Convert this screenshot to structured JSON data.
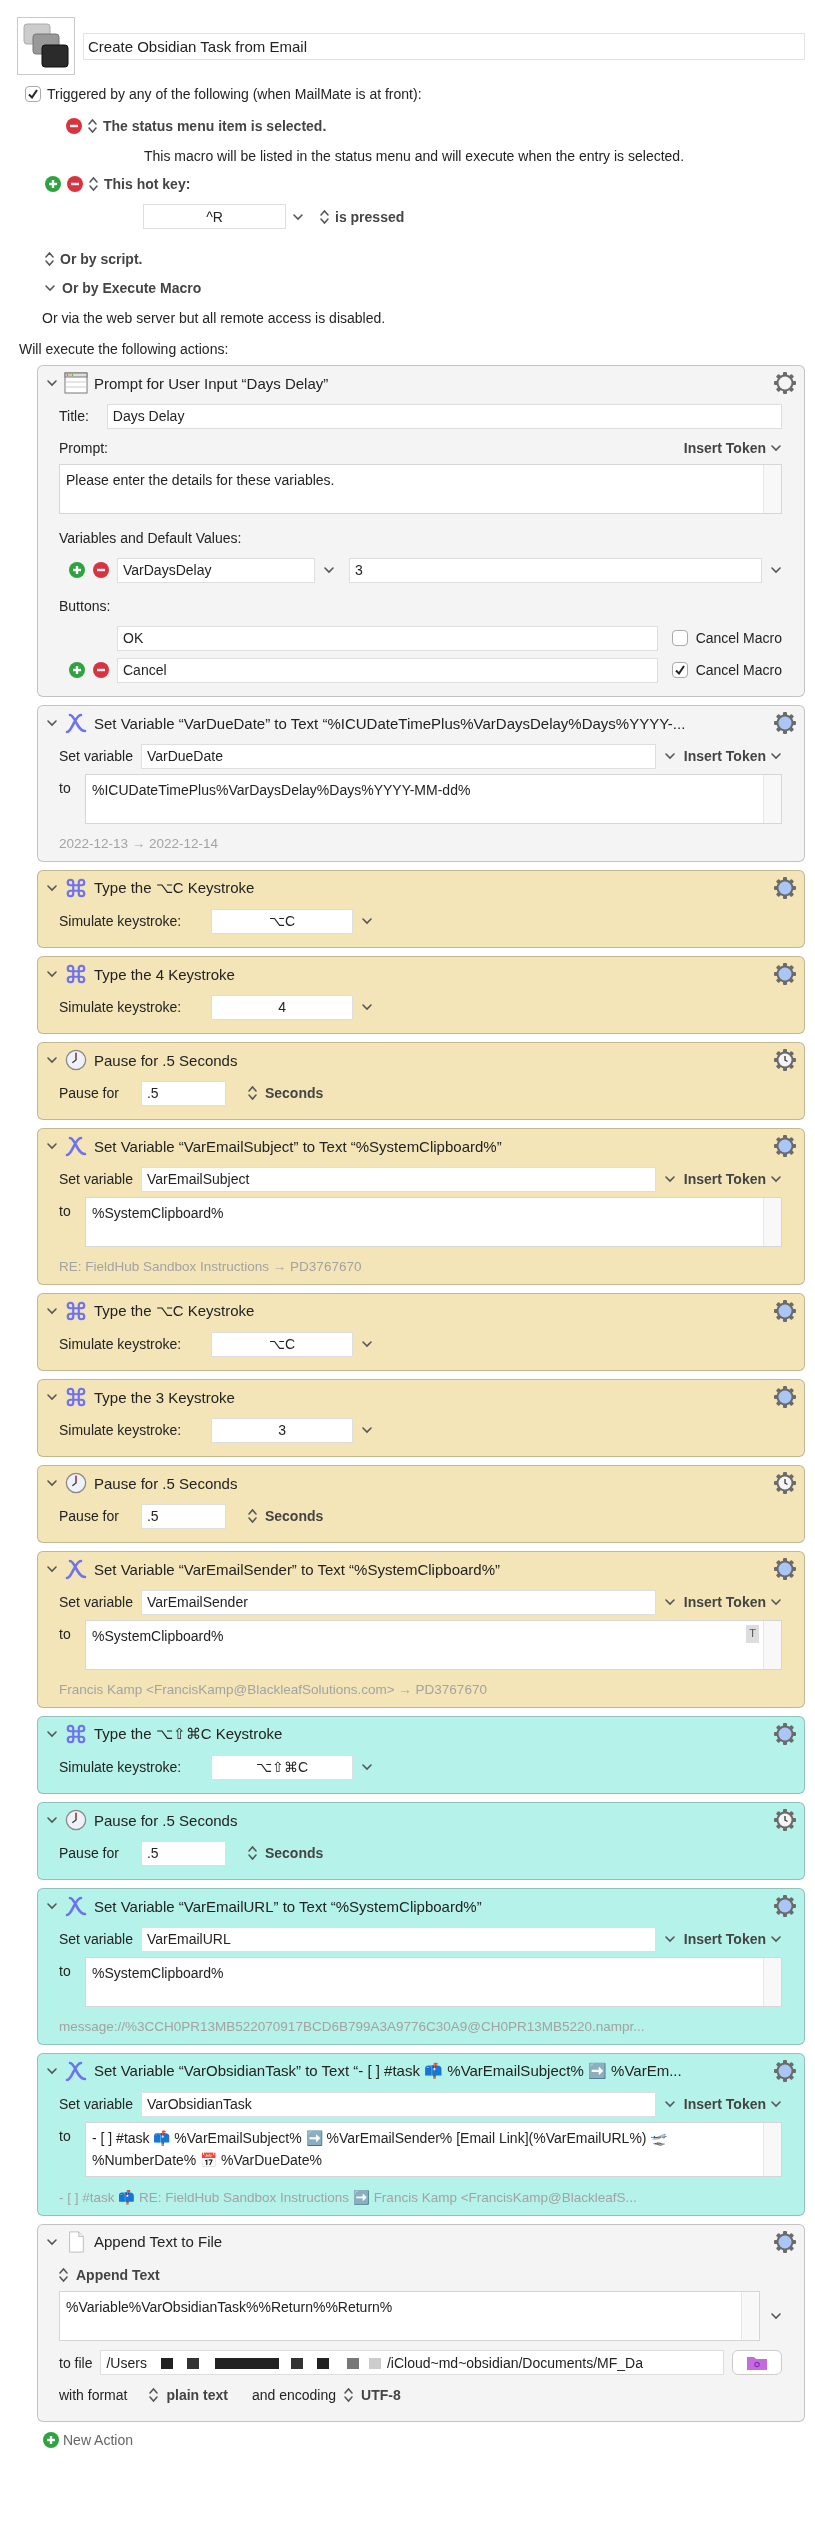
{
  "macro": {
    "title": "Create Obsidian Task from Email"
  },
  "triggers": {
    "enabled": true,
    "heading": "Triggered by any of the following (when MailMate is at front):",
    "items": [
      {
        "kind": "status_menu",
        "label": "The status menu item is selected.",
        "description": "This macro will be listed in the status menu and will execute when the entry is selected."
      },
      {
        "kind": "hotkey",
        "label": "This hot key:",
        "key": "^R",
        "condition": "is pressed"
      },
      {
        "kind": "script",
        "label": "Or by script."
      },
      {
        "kind": "execute_macro",
        "label": "Or by Execute Macro",
        "expanded": true
      }
    ],
    "remote_note": "Or via the web server but all remote access is disabled."
  },
  "actions_heading": "Will execute the following actions:",
  "actions": [
    {
      "kind": "prompt",
      "color": "#f4f4f4",
      "expanded": true,
      "title": "Prompt for User Input “Days Delay”",
      "title_label": "Title:",
      "title_value": "Days Delay",
      "prompt_label": "Prompt:",
      "insert_token": "Insert Token",
      "prompt": "Please enter the details for these variables.",
      "variables_label": "Variables and Default Values:",
      "variables": [
        {
          "name": "VarDaysDelay",
          "default": "3"
        }
      ],
      "buttons_label": "Buttons:",
      "buttons": [
        {
          "label": "OK",
          "cancel_macro": false,
          "cancel_label": "Cancel Macro"
        },
        {
          "label": "Cancel",
          "cancel_macro": true,
          "cancel_label": "Cancel Macro"
        }
      ]
    },
    {
      "kind": "set_variable",
      "color": "#f4f4f4",
      "expanded": true,
      "title": "Set Variable “VarDueDate” to Text “%ICUDateTimePlus%VarDaysDelay%Days%YYYY-...",
      "set_label": "Set variable",
      "variable": "VarDueDate",
      "insert_token": "Insert Token",
      "to_label": "to",
      "value": "%ICUDateTimePlus%VarDaysDelay%Days%YYYY-MM-dd%",
      "preview": "2022-12-13 → 2022-12-14"
    },
    {
      "kind": "keystroke",
      "color": "#f3e5b7",
      "expanded": true,
      "title": "Type the ⌥C Keystroke",
      "label": "Simulate keystroke:",
      "key": "⌥C"
    },
    {
      "kind": "keystroke",
      "color": "#f3e5b7",
      "expanded": true,
      "title": "Type the 4 Keystroke",
      "label": "Simulate keystroke:",
      "key": "4"
    },
    {
      "kind": "pause",
      "color": "#f3e5b7",
      "expanded": true,
      "title": "Pause for .5 Seconds",
      "label": "Pause for",
      "value": ".5",
      "unit": "Seconds"
    },
    {
      "kind": "set_variable",
      "color": "#f3e5b7",
      "expanded": true,
      "title": "Set Variable “VarEmailSubject” to Text “%SystemClipboard%”",
      "set_label": "Set variable",
      "variable": "VarEmailSubject",
      "insert_token": "Insert Token",
      "to_label": "to",
      "value": "%SystemClipboard%",
      "preview": "RE: FieldHub Sandbox Instructions → PD3767670"
    },
    {
      "kind": "keystroke",
      "color": "#f3e5b7",
      "expanded": true,
      "title": "Type the ⌥C Keystroke",
      "label": "Simulate keystroke:",
      "key": "⌥C"
    },
    {
      "kind": "keystroke",
      "color": "#f3e5b7",
      "expanded": true,
      "title": "Type the 3 Keystroke",
      "label": "Simulate keystroke:",
      "key": "3"
    },
    {
      "kind": "pause",
      "color": "#f3e5b7",
      "expanded": true,
      "title": "Pause for .5 Seconds",
      "label": "Pause for",
      "value": ".5",
      "unit": "Seconds"
    },
    {
      "kind": "set_variable",
      "color": "#f3e5b7",
      "expanded": true,
      "title": "Set Variable “VarEmailSender” to Text “%SystemClipboard%”",
      "set_label": "Set variable",
      "variable": "VarEmailSender",
      "insert_token": "Insert Token",
      "to_label": "to",
      "value": "%SystemClipboard%",
      "token_badge": "T",
      "preview": "Francis Kamp <FrancisKamp@BlackleafSolutions.com> → PD3767670"
    },
    {
      "kind": "keystroke",
      "color": "#b5f2e9",
      "expanded": true,
      "title": "Type the ⌥⇧⌘C Keystroke",
      "label": "Simulate keystroke:",
      "key": "⌥⇧⌘C"
    },
    {
      "kind": "pause",
      "color": "#b5f2e9",
      "expanded": true,
      "title": "Pause for .5 Seconds",
      "label": "Pause for",
      "value": ".5",
      "unit": "Seconds"
    },
    {
      "kind": "set_variable",
      "color": "#b5f2e9",
      "expanded": true,
      "title": "Set Variable “VarEmailURL” to Text “%SystemClipboard%”",
      "set_label": "Set variable",
      "variable": "VarEmailURL",
      "insert_token": "Insert Token",
      "to_label": "to",
      "value": "%SystemClipboard%",
      "preview": "message://%3CCH0PR13MB522070917BCD6B799A3A9776C30A9@CH0PR13MB5220.nampr..."
    },
    {
      "kind": "set_variable",
      "color": "#b5f2e9",
      "expanded": true,
      "title": "Set Variable “VarObsidianTask” to Text “- [ ] #task 📫 %VarEmailSubject% ➡️ %VarEm...",
      "set_label": "Set variable",
      "variable": "VarObsidianTask",
      "insert_token": "Insert Token",
      "to_label": "to",
      "value": "- [ ] #task 📫 %VarEmailSubject% ➡️ %VarEmailSender% [Email Link](%VarEmailURL%) 🛫 %NumberDate% 📅 %VarDueDate%",
      "preview": "- [ ] #task 📫 RE: FieldHub Sandbox Instructions ➡️ Francis Kamp <FrancisKamp@BlackleafS..."
    },
    {
      "kind": "append_file",
      "color": "#f4f4f4",
      "expanded": true,
      "title": "Append Text to File",
      "mode": "Append Text",
      "text": "%Variable%VarObsidianTask%%Return%%Return%",
      "file_label": "to file",
      "path_start": "/Users",
      "path_end": "/iCloud~md~obsidian/Documents/MF_Da",
      "format_label": "with format",
      "format": "plain text",
      "encoding_label": "and encoding",
      "encoding": "UTF-8"
    }
  ],
  "new_action": "New Action"
}
